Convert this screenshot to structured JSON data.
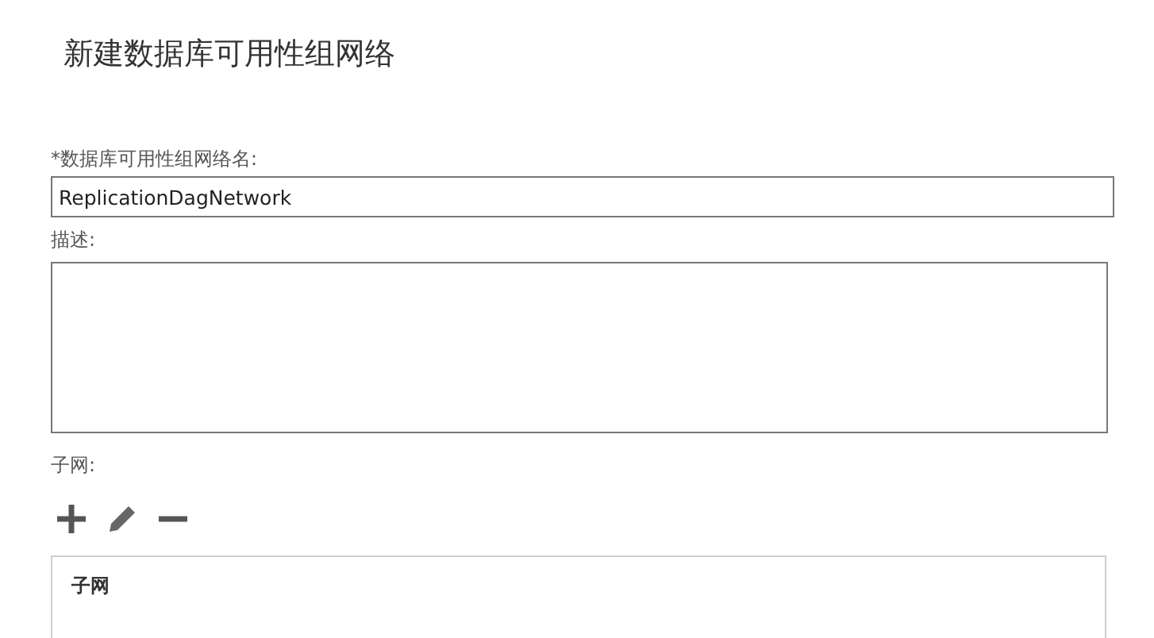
{
  "title": "新建数据库可用性组网络",
  "name_field": {
    "label": "*数据库可用性组网络名:",
    "value": "ReplicationDagNetwork"
  },
  "description_field": {
    "label": "描述:"
  },
  "subnets": {
    "label": "子网:",
    "toolbar": [
      {
        "kind": "add"
      },
      {
        "kind": "edit"
      },
      {
        "kind": "remove"
      }
    ],
    "table": {
      "columns": [
        "子网"
      ]
    }
  }
}
